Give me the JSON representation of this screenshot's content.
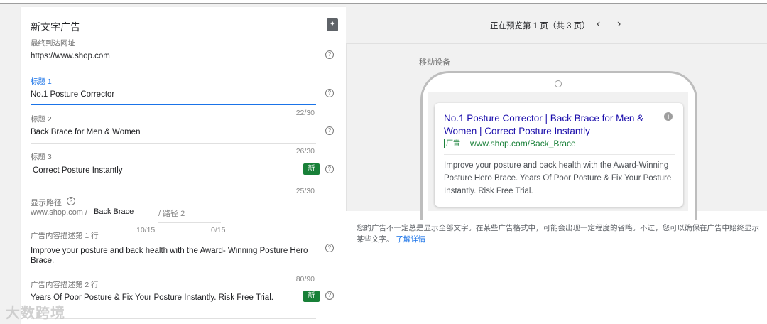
{
  "form": {
    "title": "新文字广告",
    "final_url": {
      "label": "最终到达网址",
      "value": "https://www.shop.com"
    },
    "headline1": {
      "label": "标题 1",
      "value": "No.1 Posture Corrector",
      "count": "22/30"
    },
    "headline2": {
      "label": "标题 2",
      "value": "Back Brace for Men & Women",
      "count": "26/30"
    },
    "headline3": {
      "label": "标题 3",
      "value": "Correct Posture Instantly",
      "count": "25/30",
      "badge": "新"
    },
    "display_path": {
      "label": "显示路径",
      "domain": "www.shop.com /",
      "path1": "Back Brace",
      "path2_placeholder": "/ 路径 2",
      "path1_count": "10/15",
      "path2_count": "0/15"
    },
    "desc1": {
      "label": "广告内容描述第 1 行",
      "value": "Improve your posture and back health with the Award- Winning Posture Hero Brace.",
      "count": "80/90"
    },
    "desc2": {
      "label": "广告内容描述第 2 行",
      "value": "Years Of Poor Posture & Fix Your Posture Instantly. Risk Free Trial.",
      "badge": "新"
    },
    "help": "?"
  },
  "preview": {
    "pager": "正在预览第 1 页（共 3 页）",
    "prev": "‹",
    "next": "›",
    "device_label": "移动设备",
    "ad": {
      "headline": "No.1 Posture Corrector | Back Brace for Men & Women | Correct Posture Instantly",
      "ad_tag": "广告",
      "url": "www.shop.com/Back_Brace",
      "description": "Improve your posture and back health with the Award-Winning Posture Hero Brace. Years Of Poor Posture & Fix Your Posture Instantly. Risk Free Trial."
    },
    "note": "您的广告不一定总是显示全部文字。在某些广告格式中，可能会出现一定程度的省略。不过，您可以确保在广告中始终显示某些文字。",
    "learn_more": "了解详情"
  },
  "watermark": "大数跨境",
  "colors": {
    "accent": "#1a73e8",
    "badge": "#188038",
    "ad_title": "#1a0dab",
    "ad_url": "#188038"
  }
}
